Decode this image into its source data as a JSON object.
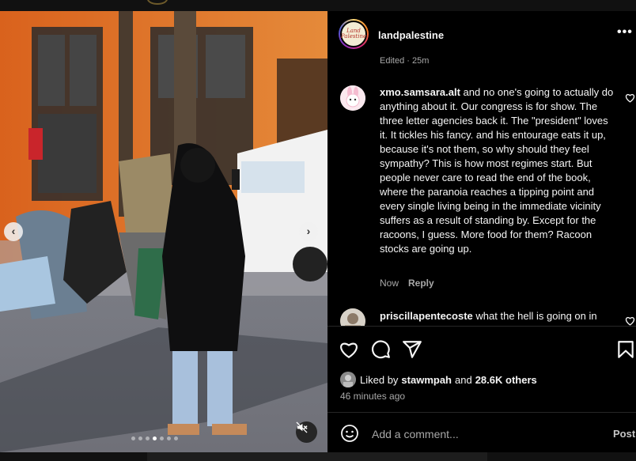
{
  "post": {
    "username": "landpalestine",
    "avatar_text": "Land Palestine",
    "edited_label": "Edited · 25m",
    "more_label": "•••"
  },
  "comments": [
    {
      "username": "xmo.samsara.alt",
      "text": "and no one's going to actually do anything about it. Our congress is for show. The three letter agencies back it. The \"president\" loves it. It tickles his fancy. and his entourage eats it up, because it's not them, so why should they feel sympathy? This is how most regimes start. But people never care to read the end of the book, where the paranoia reaches a tipping point and every single living being in the immediate vicinity suffers as a result of standing by. Except for the racoons, I guess. More food for them? Racoon stocks are going up.",
      "time": "Now",
      "reply": "Reply"
    },
    {
      "username": "priscillapentecoste",
      "text": "what the hell is going on in the... what the actual hell is this",
      "time": "",
      "reply": ""
    }
  ],
  "likes": {
    "prefix": "Liked by",
    "user": "stawmpah",
    "and": "and",
    "others": "28.6K others"
  },
  "timestamp": "46 minutes ago",
  "add_comment": {
    "placeholder": "Add a comment...",
    "post_label": "Post"
  },
  "carousel": {
    "slide_count": 7,
    "active_index": 3,
    "prev_glyph": "‹",
    "next_glyph": "›"
  },
  "icons": {
    "like": "heart-icon",
    "comment": "comment-icon",
    "share": "share-icon",
    "save": "bookmark-icon",
    "emoji": "smile-icon",
    "mute": "speaker-muted-icon"
  }
}
